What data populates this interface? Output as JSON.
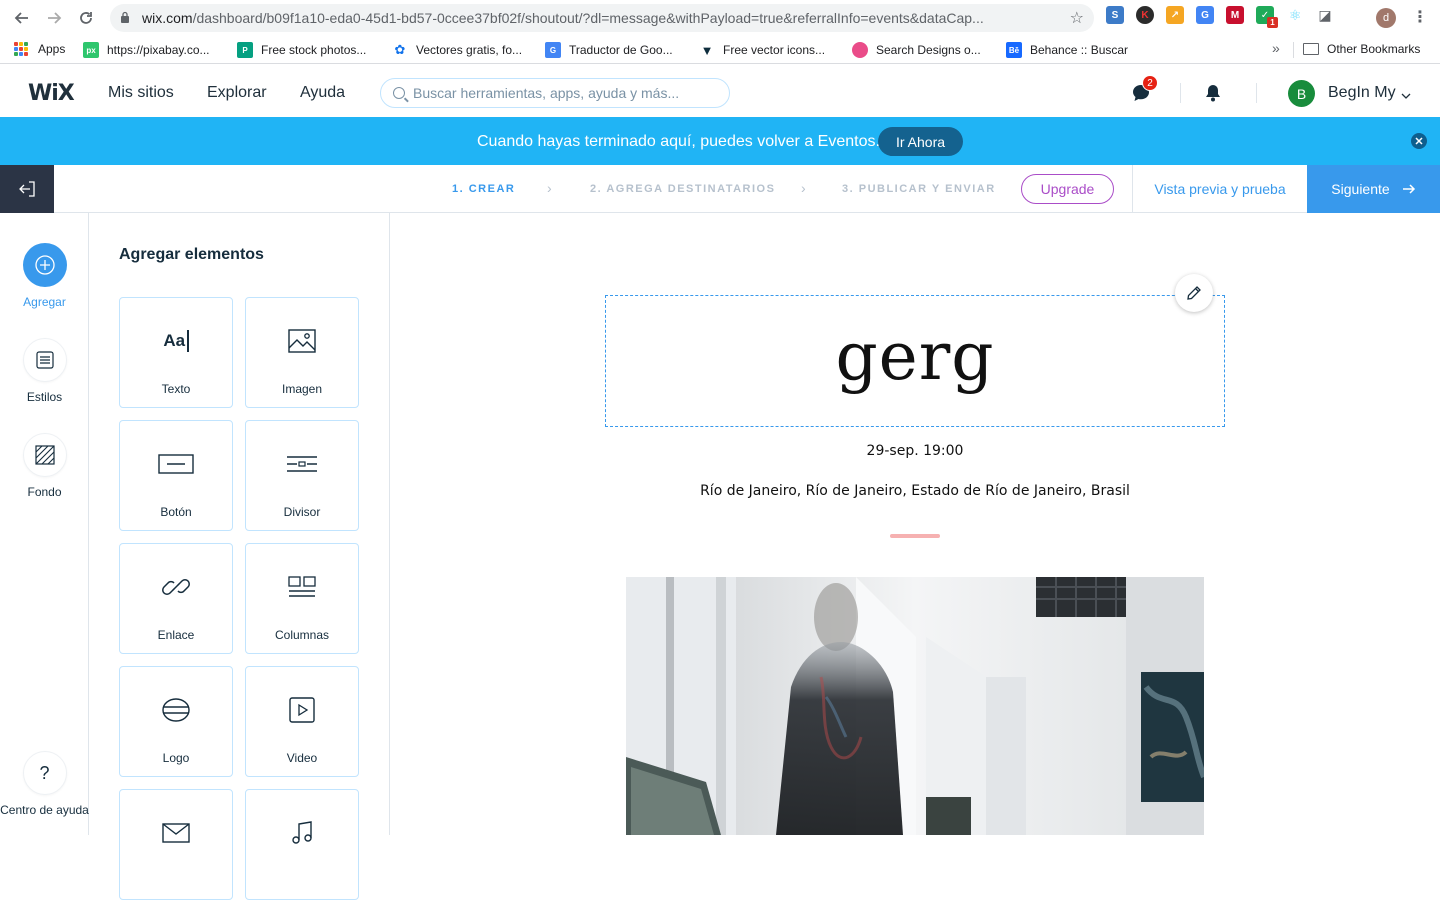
{
  "browser": {
    "url_host": "wix.com",
    "url_rest": "/dashboard/b09f1a10-eda0-45d1-bd57-0ccee37bf02f/shoutout/?dl=message&withPayload=true&referralInfo=events&dataCap...",
    "profile_initial": "d",
    "ext_badge": "1"
  },
  "bookmarks": [
    {
      "label": "Apps"
    },
    {
      "label": "https://pixabay.co...",
      "icon_text": "px",
      "color": "#2ec66d"
    },
    {
      "label": "Free stock photos...",
      "icon_text": "P",
      "color": "#05a081"
    },
    {
      "label": "Vectores gratis, fo...",
      "icon_text": "",
      "color": "#1273eb"
    },
    {
      "label": "Traductor de Goo...",
      "icon_text": "G",
      "color": "#4285f4"
    },
    {
      "label": "Free vector icons...",
      "icon_text": "F",
      "color": "#0e2d3d"
    },
    {
      "label": "Search Designs o...",
      "icon_text": "",
      "color": "#ea4c89"
    },
    {
      "label": "Behance :: Buscar",
      "icon_text": "Bē",
      "color": "#1769ff"
    }
  ],
  "other_bookmarks": "Other Bookmarks",
  "wix": {
    "logo": "WiX",
    "nav": [
      "Mis sitios",
      "Explorar",
      "Ayuda"
    ],
    "search_placeholder": "Buscar herramientas, apps, ayuda y más...",
    "chat_badge": "2",
    "avatar_initial": "B",
    "user_name": "BegIn My"
  },
  "banner": {
    "message": "Cuando hayas terminado aquí, puedes volver a Eventos.",
    "button": "Ir Ahora"
  },
  "steps": {
    "items": [
      "1. CREAR",
      "2. AGREGA DESTINATARIOS",
      "3. PUBLICAR Y ENVIAR"
    ],
    "upgrade": "Upgrade",
    "preview": "Vista previa y prueba",
    "next": "Siguiente"
  },
  "rail": {
    "add": "Agregar",
    "styles": "Estilos",
    "background": "Fondo",
    "help": "Centro de ayuda",
    "help_icon": "?"
  },
  "panel": {
    "title": "Agregar elementos",
    "tiles": [
      "Texto",
      "Imagen",
      "Botón",
      "Divisor",
      "Enlace",
      "Columnas",
      "Logo",
      "Video"
    ],
    "text_icon": "Aa"
  },
  "canvas": {
    "event_title": "gerg",
    "date": "29-sep. 19:00",
    "location": "Río de Janeiro, Río de Janeiro, Estado de Río de Janeiro, Brasil"
  },
  "colors": {
    "accent": "#3899ec",
    "banner": "#20b4f5",
    "upgrade": "#aa4dc8",
    "divider": "#f6b1b1"
  }
}
